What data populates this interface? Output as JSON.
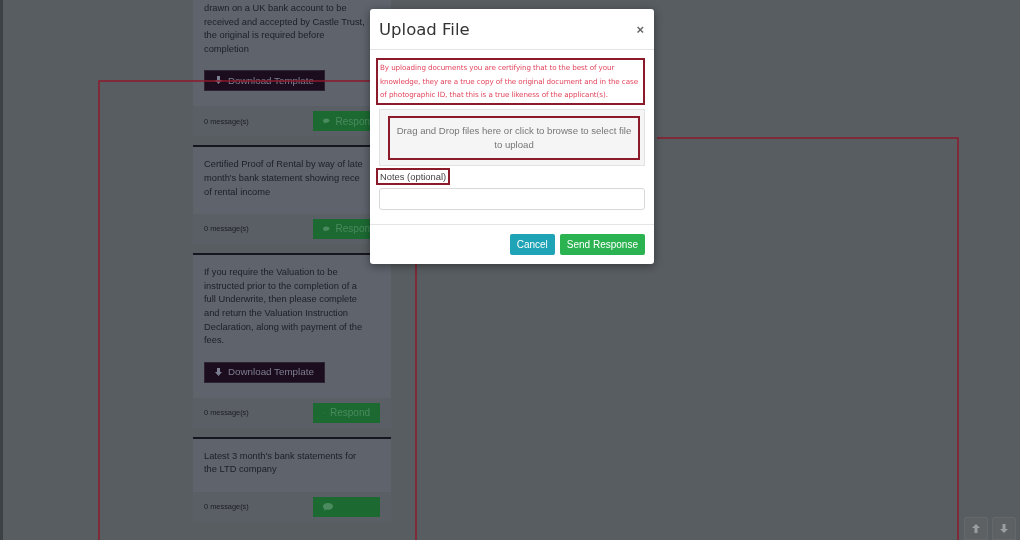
{
  "background_cards": [
    {
      "text": "drawn on a UK bank account to be received and accepted by Castle Trust, the original is required before completion",
      "download_button": "Download Template",
      "messages": "0 message(s)",
      "respond_button": "Respon"
    },
    {
      "text": "Certified Proof of Rental by way of late month's bank statement showing rece of rental income",
      "messages": "0 message(s)",
      "respond_button": "Respon"
    },
    {
      "text": "If you require the Valuation to be instructed prior to the completion of a full Underwrite, then please complete and return the Valuation Instruction Declaration, along with payment of the fees.",
      "download_button": "Download Template",
      "messages": "0 message(s)",
      "respond_button": "Respond"
    },
    {
      "text": "Latest 3 month's bank statements for the LTD company",
      "messages": "0 message(s)"
    }
  ],
  "modal": {
    "title": "Upload File",
    "close": "×",
    "disclaimer": "By uploading documents you are certifying that to the best of your knowledge, they are a true copy of the original document and in the case of photographic ID, that this is a true likeness of the applicant(s).",
    "dropzone": "Drag and Drop files here or click to browse to select file to upload",
    "notes_label": "Notes (optional)",
    "buttons": [
      {
        "label": "Cancel",
        "kind": "secondary"
      },
      {
        "label": "Send Response",
        "kind": "primary"
      }
    ]
  },
  "scroll_buttons": [
    {
      "kind": "up"
    },
    {
      "kind": "down"
    }
  ]
}
